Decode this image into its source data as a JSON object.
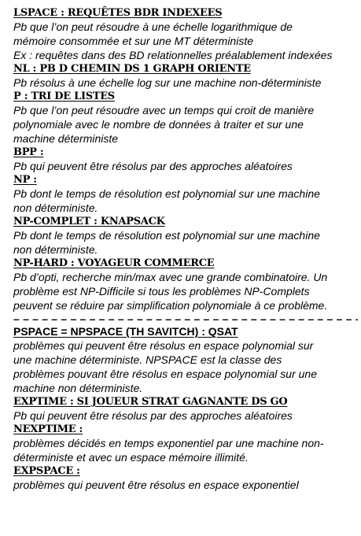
{
  "sections": [
    {
      "heading": "LSPACE : REQUÊTES BDR INDEXEES",
      "lines": [
        "Pb que l’on peut résoudre à une échelle logarithmique de",
        "mémoire consommée et sur une MT déterministe",
        "Ex : requêtes dans des BD relationnelles préalablement indexées"
      ]
    },
    {
      "heading": "NL : PB D CHEMIN DS 1 GRAPH ORIENTE",
      "lines": [
        "Pb résolus à une échelle log sur une machine non-déterministe"
      ]
    },
    {
      "heading": "P : TRI DE LISTES",
      "lines": [
        "Pb que l’on peut résoudre avec un temps qui croit de manière",
        "polynomiale avec le nombre de données à traiter et sur une",
        "machine déterministe"
      ]
    },
    {
      "heading": "BPP :",
      "lines": [
        "Pb qui peuvent être résolus par des approches aléatoires"
      ]
    },
    {
      "heading": "NP :",
      "lines": [
        "Pb dont le temps de résolution est polynomial sur une machine",
        "non déterministe."
      ]
    },
    {
      "heading": "NP-COMPLET : KNAPSACK",
      "lines": [
        "Pb dont le temps de résolution est polynomial sur une machine",
        "non déterministe."
      ]
    },
    {
      "heading": "NP-HARD : VOYAGEUR COMMERCE",
      "lines": [
        "Pb d’opti, recherche min/max avec une grande combinatoire. Un",
        "problème est NP-Difficile si tous les problèmes NP-Complets",
        "peuvent se réduire par simplification polynomiale à ce problème."
      ]
    },
    {
      "separator": "– – – – – – – – – – – – – – – – – – – – – – – – – – – – – – – – – – – – – –"
    },
    {
      "heading": "PSPACE = NPSPACE (TH SAVITCH) : QSAT",
      "lines": [
        "problèmes qui peuvent être résolus en espace polynomial sur",
        "une machine déterministe. NPSPACE est la classe des",
        "problèmes pouvant être résolus en espace polynomial sur une",
        "machine non déterministe."
      ]
    },
    {
      "heading": "EXPTIME : SI JOUEUR STRAT GAGNANTE DS GO",
      "lines": [
        "Pb qui peuvent être résolus par des approches aléatoires"
      ]
    },
    {
      "heading": "NEXPTIME :",
      "lines": [
        "problèmes décidés en temps exponentiel par une machine non-",
        "déterministe et avec un espace mémoire illimité."
      ]
    },
    {
      "heading": "EXPSPACE :",
      "lines": [
        "problèmes qui peuvent être résolus en espace exponentiel"
      ]
    }
  ]
}
